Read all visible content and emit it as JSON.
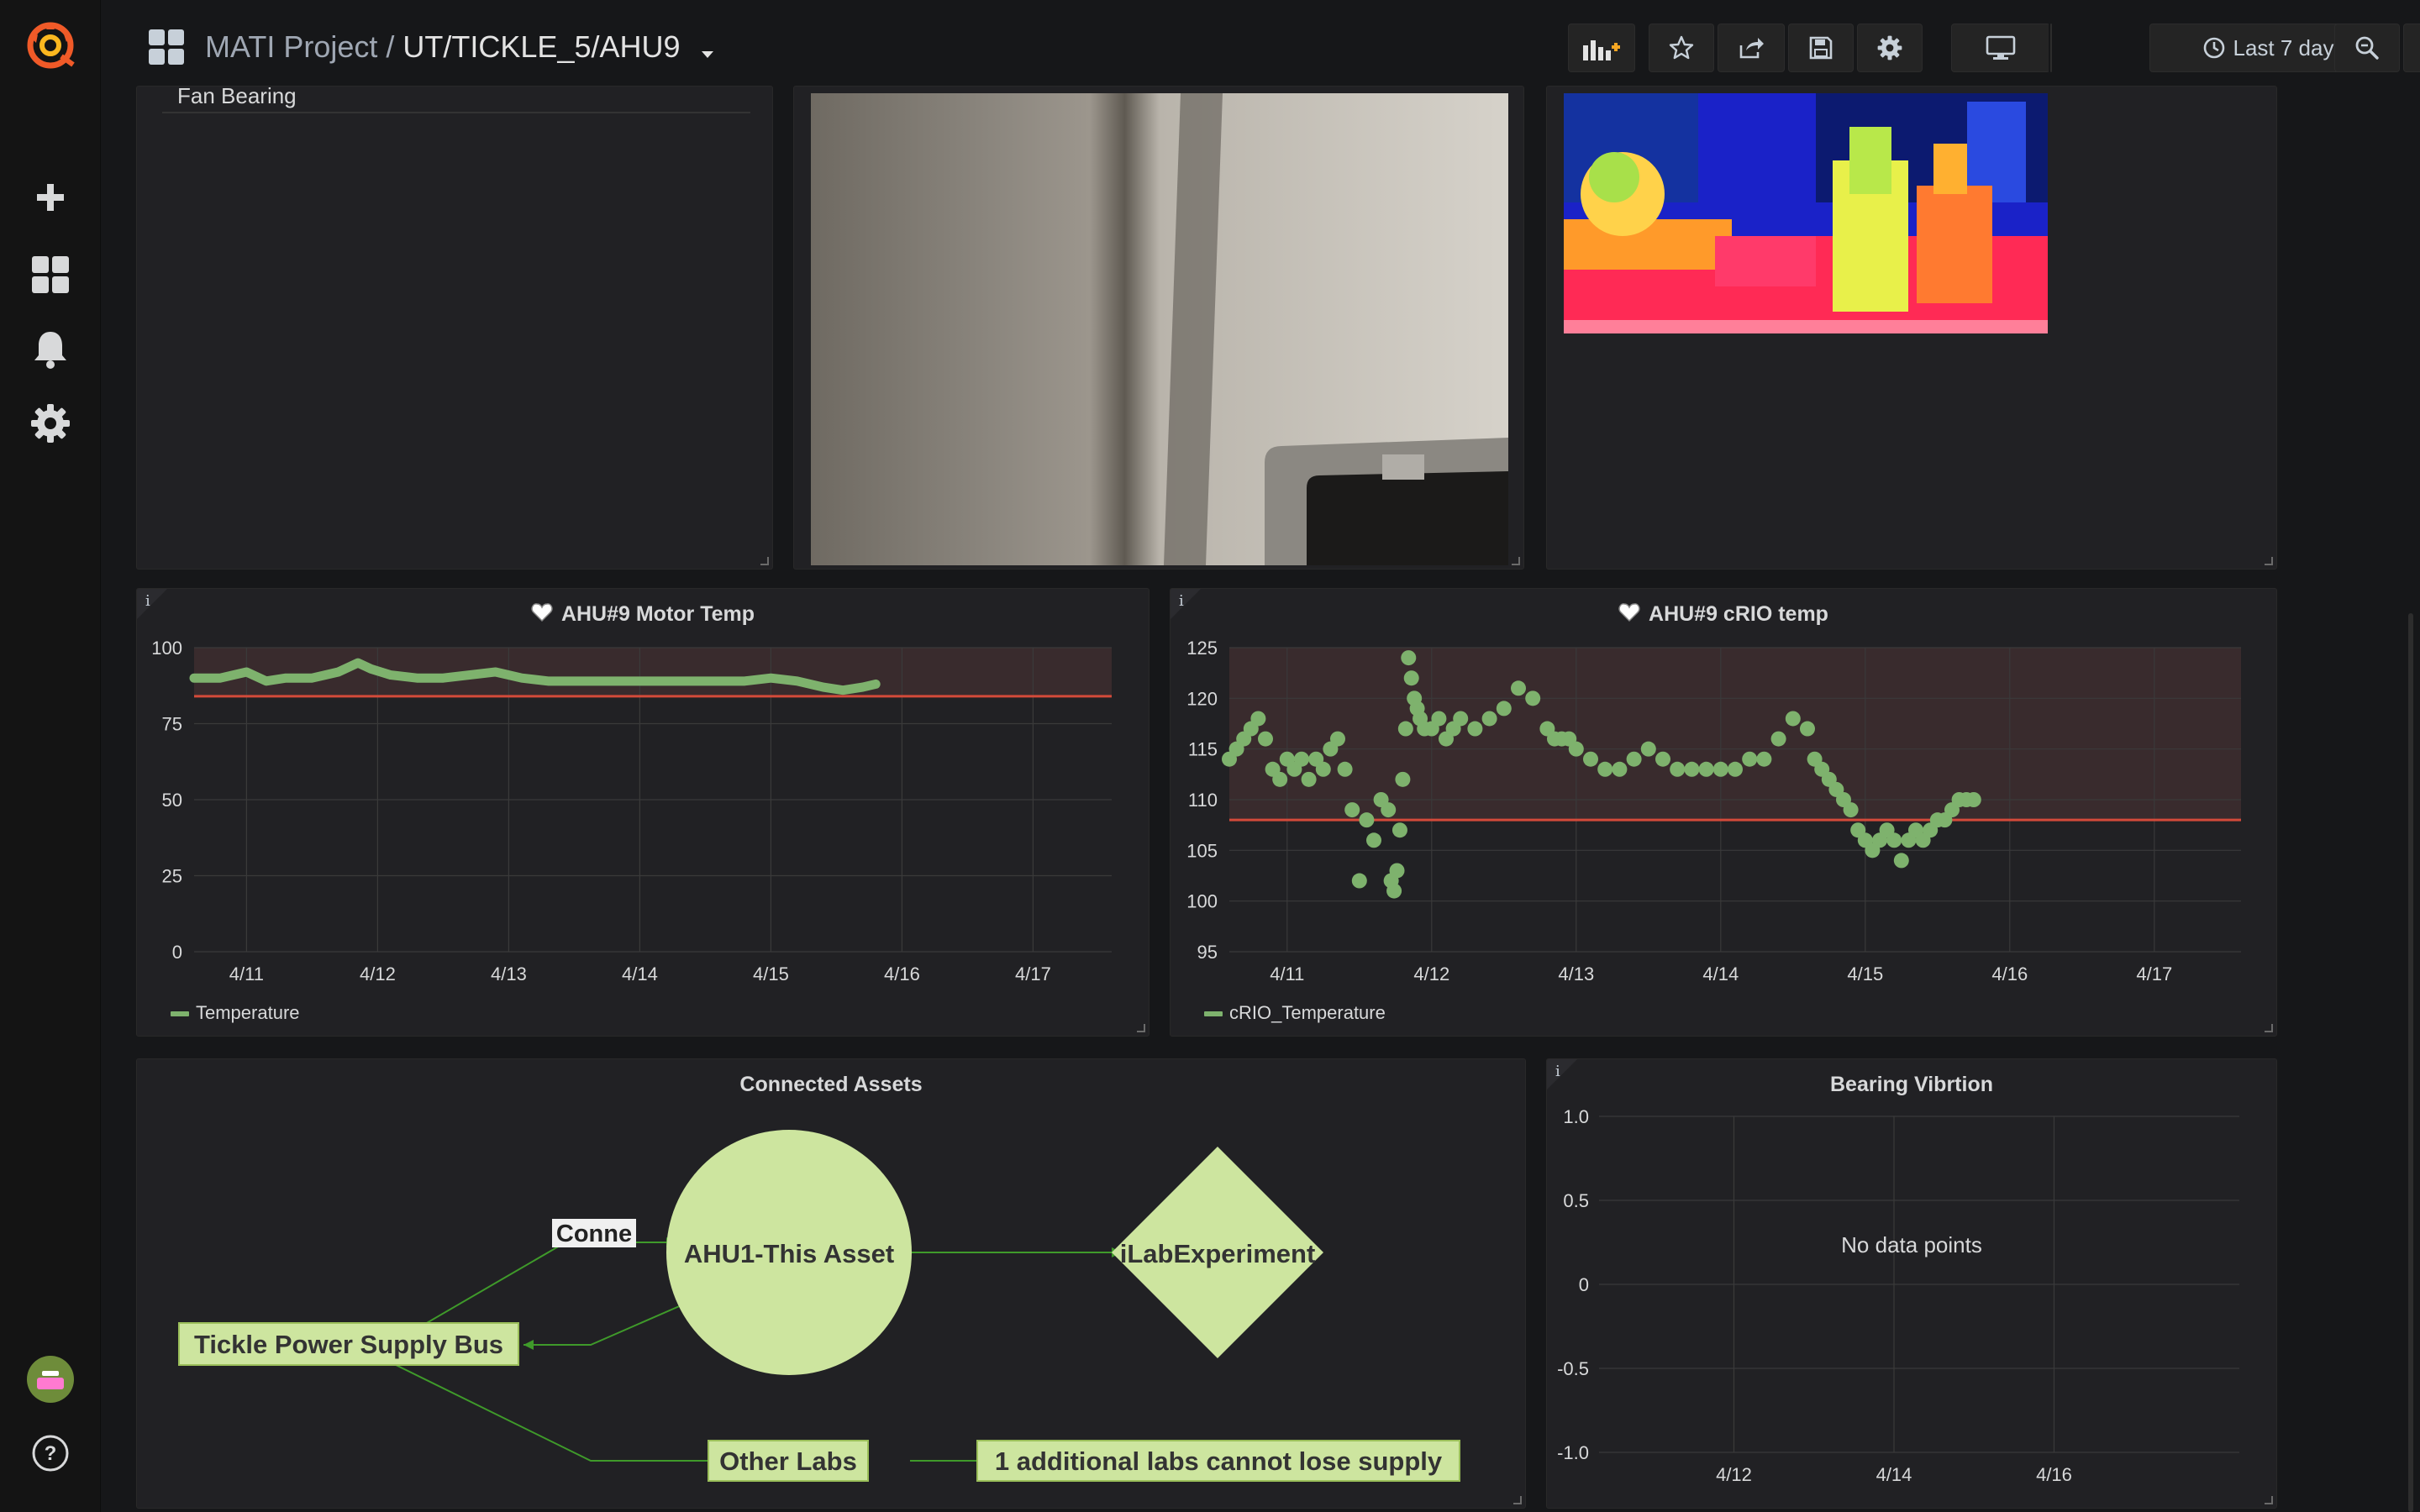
{
  "colors": {
    "series_green": "#7eb26d",
    "threshold_red": "#d44a3a",
    "node_fill": "#cde59f",
    "grafana_orange": "#f05a28"
  },
  "sidemenu": {
    "icons": [
      "grafana-logo-icon",
      "plus-icon",
      "dashboards-icon",
      "bell-icon",
      "gear-icon",
      "user-avatar",
      "help-icon"
    ]
  },
  "header": {
    "folder": "MATI Project",
    "separator": "/",
    "title": "UT/TICKLE_5/AHU9",
    "time_range": "Last 7 days"
  },
  "panels": {
    "fan_bearing": {
      "title": "Fan Bearing"
    },
    "motor_temp": {
      "title": "AHU#9 Motor Temp",
      "legend": "Temperature"
    },
    "crio_temp": {
      "title": "AHU#9 cRIO temp",
      "legend": "cRIO_Temperature"
    },
    "connected_assets": {
      "title": "Connected Assets",
      "nodes": {
        "this_asset": "AHU1-This Asset",
        "experiment": "iLabExperiment",
        "power_bus": "Tickle Power Supply Bus",
        "other_labs": "Other Labs",
        "additional": "1 additional labs cannot lose supply",
        "edge_label": "Conne"
      }
    },
    "bearing_vibration": {
      "title": "Bearing Vibrtion",
      "no_data": "No data points"
    }
  },
  "chart_data": [
    {
      "name": "motor_temp",
      "type": "line",
      "title": "AHU#9 Motor Temp",
      "x_ticks": [
        "4/11",
        "4/12",
        "4/13",
        "4/14",
        "4/15",
        "4/16",
        "4/17"
      ],
      "y_ticks": [
        0,
        25,
        50,
        75,
        100
      ],
      "ylim": [
        0,
        100
      ],
      "xlim": [
        10.6,
        17.6
      ],
      "threshold": 84,
      "series": [
        {
          "name": "Temperature",
          "x": [
            10.6,
            10.8,
            11.0,
            11.15,
            11.3,
            11.5,
            11.7,
            11.85,
            11.95,
            12.1,
            12.3,
            12.5,
            12.7,
            12.9,
            13.1,
            13.3,
            13.6,
            13.9,
            14.2,
            14.5,
            14.8,
            15.0,
            15.2,
            15.4,
            15.55,
            15.7,
            15.8
          ],
          "y": [
            90,
            90,
            92,
            89,
            90,
            90,
            92,
            95,
            93,
            91,
            90,
            90,
            91,
            92,
            90,
            89,
            89,
            89,
            89,
            89,
            89,
            90,
            89,
            87,
            86,
            87,
            88
          ]
        }
      ],
      "grid": true,
      "legend_position": "bottom-left"
    },
    {
      "name": "crio_temp",
      "type": "scatter",
      "title": "AHU#9 cRIO temp",
      "x_ticks": [
        "4/11",
        "4/12",
        "4/13",
        "4/14",
        "4/15",
        "4/16",
        "4/17"
      ],
      "y_ticks": [
        95,
        100,
        105,
        110,
        115,
        120,
        125
      ],
      "ylim": [
        95,
        125
      ],
      "xlim": [
        10.6,
        17.6
      ],
      "threshold": 108,
      "series": [
        {
          "name": "cRIO_Temperature",
          "x": [
            10.6,
            10.65,
            10.7,
            10.75,
            10.8,
            10.85,
            10.9,
            10.95,
            11.0,
            11.05,
            11.1,
            11.15,
            11.2,
            11.25,
            11.3,
            11.35,
            11.4,
            11.45,
            11.5,
            11.55,
            11.6,
            11.65,
            11.7,
            11.72,
            11.74,
            11.76,
            11.78,
            11.8,
            11.82,
            11.84,
            11.86,
            11.88,
            11.9,
            11.92,
            11.95,
            12.0,
            12.05,
            12.1,
            12.15,
            12.2,
            12.3,
            12.4,
            12.5,
            12.6,
            12.7,
            12.8,
            12.85,
            12.9,
            12.95,
            13.0,
            13.1,
            13.2,
            13.3,
            13.4,
            13.5,
            13.6,
            13.7,
            13.8,
            13.9,
            14.0,
            14.1,
            14.2,
            14.3,
            14.4,
            14.5,
            14.6,
            14.65,
            14.7,
            14.75,
            14.8,
            14.85,
            14.9,
            14.95,
            15.0,
            15.05,
            15.1,
            15.15,
            15.2,
            15.25,
            15.3,
            15.35,
            15.4,
            15.45,
            15.5,
            15.55,
            15.6,
            15.65,
            15.7,
            15.75
          ],
          "y": [
            114,
            115,
            116,
            117,
            118,
            116,
            113,
            112,
            114,
            113,
            114,
            112,
            114,
            113,
            115,
            116,
            113,
            109,
            102,
            108,
            106,
            110,
            109,
            102,
            101,
            103,
            107,
            112,
            117,
            124,
            122,
            120,
            119,
            118,
            117,
            117,
            118,
            116,
            117,
            118,
            117,
            118,
            119,
            121,
            120,
            117,
            116,
            116,
            116,
            115,
            114,
            113,
            113,
            114,
            115,
            114,
            113,
            113,
            113,
            113,
            113,
            114,
            114,
            116,
            118,
            117,
            114,
            113,
            112,
            111,
            110,
            109,
            107,
            106,
            105,
            106,
            107,
            106,
            104,
            106,
            107,
            106,
            107,
            108,
            108,
            109,
            110,
            110,
            110
          ]
        }
      ],
      "grid": true,
      "legend_position": "bottom-left"
    },
    {
      "name": "bearing_vibration",
      "type": "line",
      "title": "Bearing Vibrtion",
      "x_ticks": [
        "4/12",
        "4/14",
        "4/16"
      ],
      "y_ticks": [
        "1.0",
        "0.5",
        "0",
        "-0.5",
        "-1.0"
      ],
      "ylim": [
        -1.0,
        1.0
      ],
      "series": [],
      "grid": true
    }
  ]
}
